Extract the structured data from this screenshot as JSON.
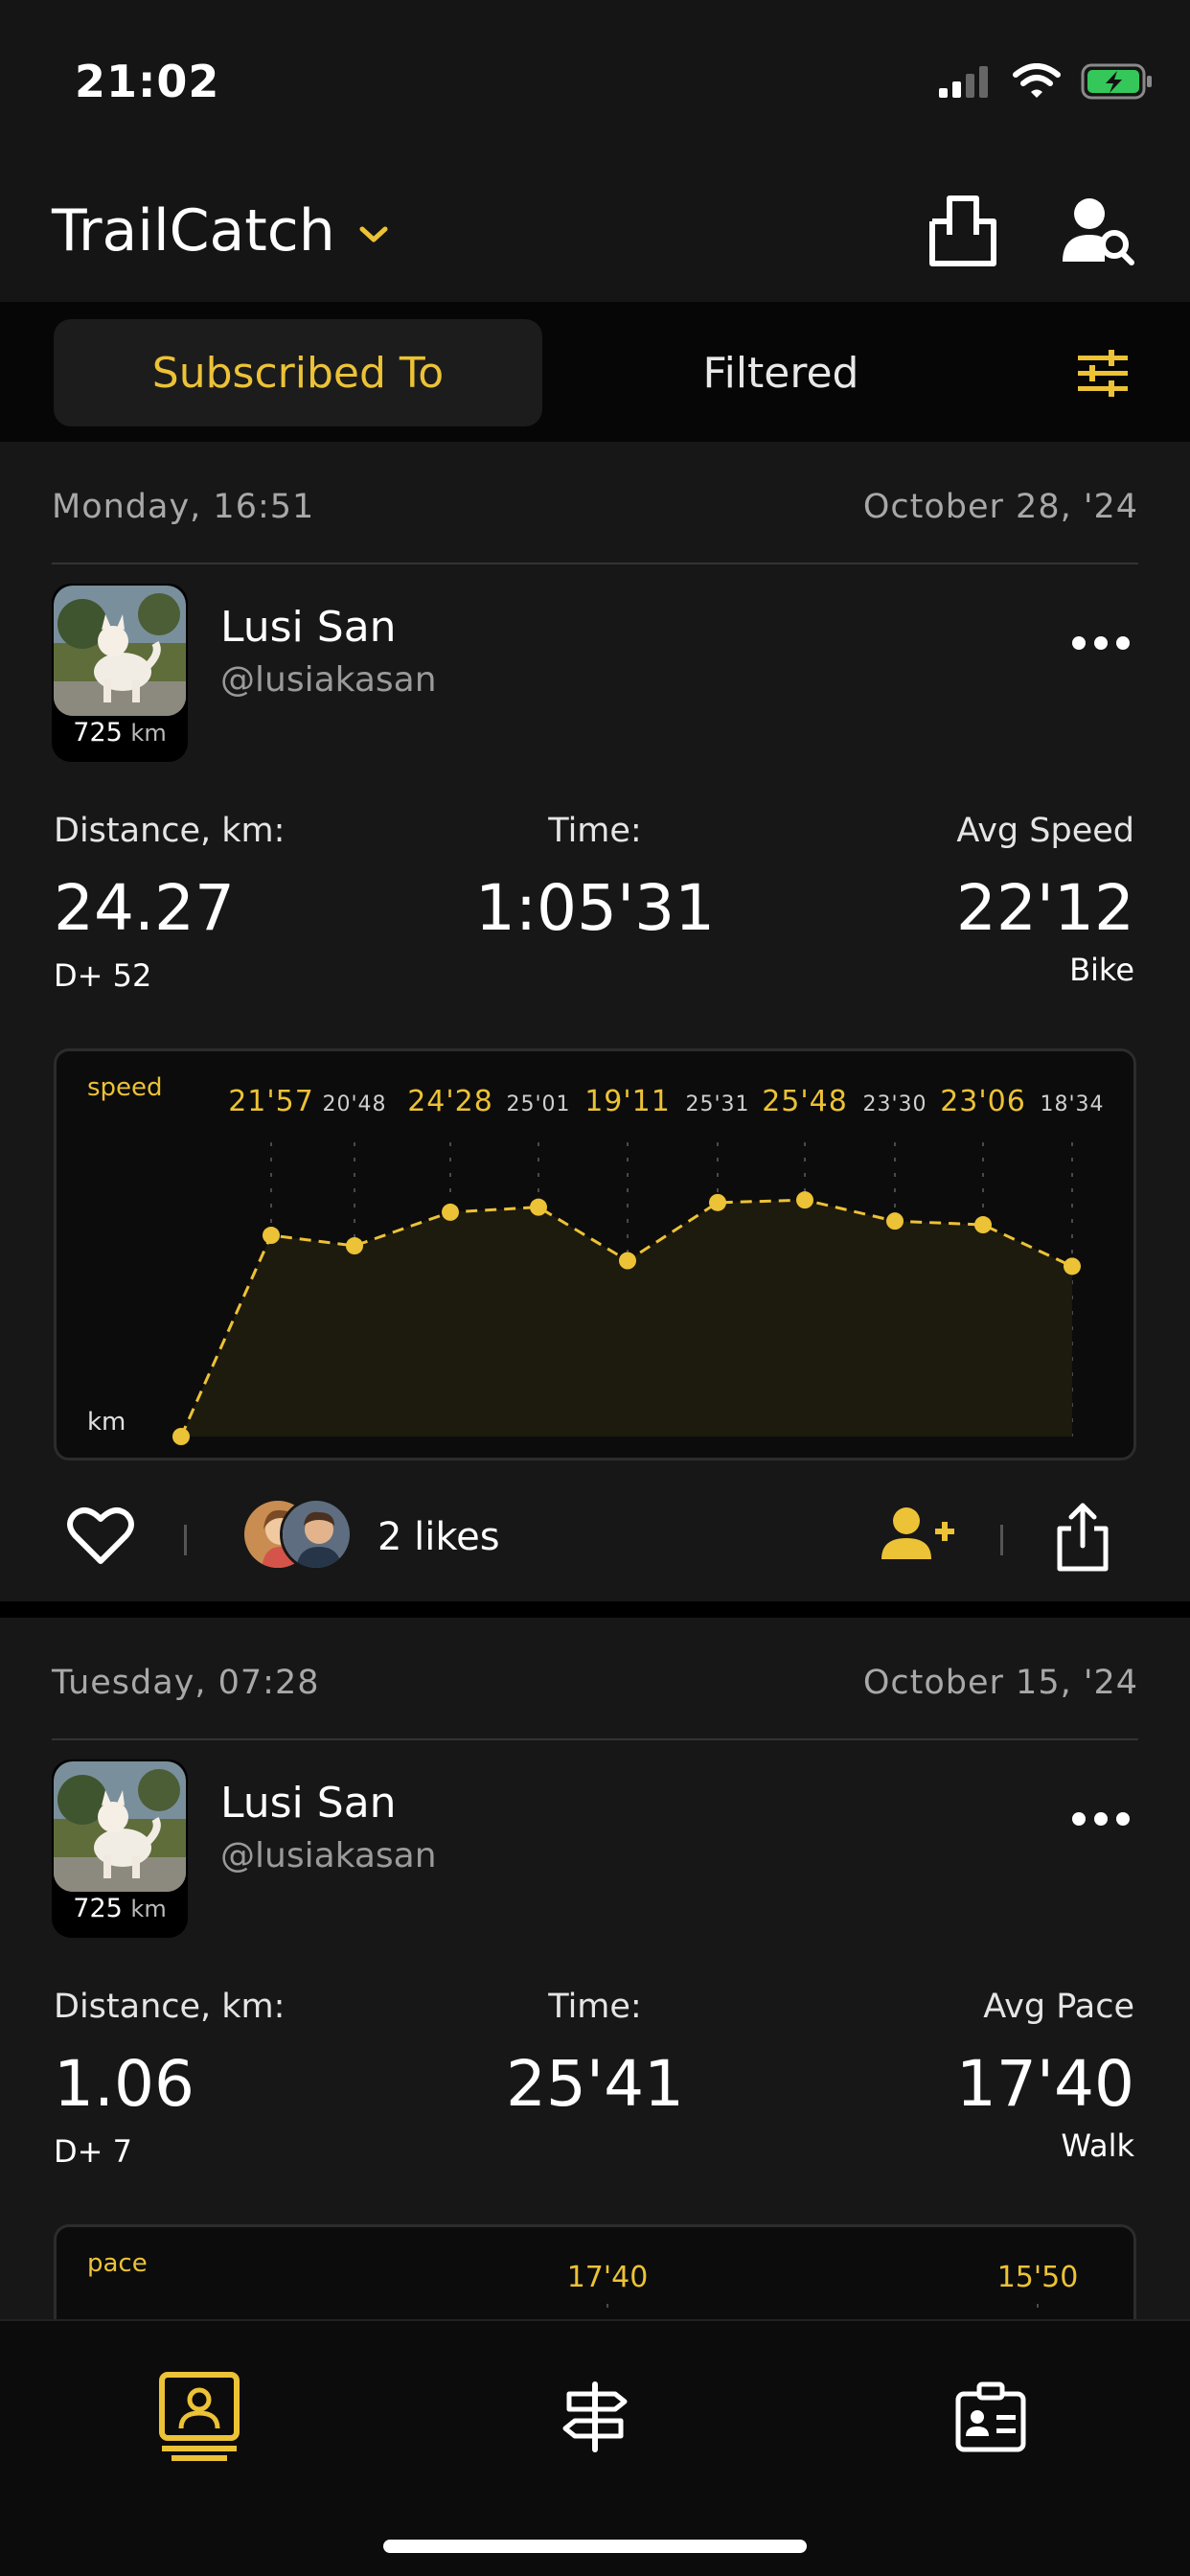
{
  "status_bar": {
    "time": "21:02"
  },
  "header": {
    "title": "TrailCatch"
  },
  "tabs": {
    "active": "Subscribed To",
    "inactive": "Filtered"
  },
  "colors": {
    "accent": "#ECC236",
    "background": "#171717"
  },
  "icons": [
    "chevron-down-icon",
    "upload-box-icon",
    "user-search-icon",
    "sliders-icon",
    "more-icon",
    "heart-icon",
    "add-user-icon",
    "share-icon",
    "profile-card-icon",
    "signpost-icon",
    "id-badge-icon"
  ],
  "posts": [
    {
      "day_time": "Monday, 16:51",
      "date": "October 28, '24",
      "avatar_km": "725",
      "avatar_km_unit": "km",
      "name": "Lusi San",
      "handle": "@lusiakasan",
      "stat1_label": "Distance, km:",
      "stat1_value": "24.27",
      "stat1_sub": "D+ 52",
      "stat2_label": "Time:",
      "stat2_value": "1:05'31",
      "stat3_label": "Avg Speed",
      "stat3_value": "22'12",
      "activity": "Bike",
      "likes": "2 likes"
    },
    {
      "day_time": "Tuesday, 07:28",
      "date": "October 15, '24",
      "avatar_km": "725",
      "avatar_km_unit": "km",
      "name": "Lusi San",
      "handle": "@lusiakasan",
      "stat1_label": "Distance, km:",
      "stat1_value": "1.06",
      "stat1_sub": "D+ 7",
      "stat2_label": "Time:",
      "stat2_value": "25'41",
      "stat3_label": "Avg Pace",
      "stat3_value": "17'40",
      "activity": "Walk"
    }
  ],
  "chart_data": [
    {
      "type": "area",
      "ylabel": "speed",
      "xlabel": "km",
      "top_labels": [
        "21'57",
        "20'48",
        "24'28",
        "25'01",
        "19'11",
        "25'31",
        "25'48",
        "23'30",
        "23'06",
        "18'34"
      ],
      "values": [
        0,
        21.95,
        20.8,
        24.47,
        25.02,
        19.18,
        25.52,
        25.8,
        23.5,
        23.1,
        18.57
      ],
      "ylim": [
        0,
        30
      ]
    },
    {
      "type": "area",
      "ylabel": "pace",
      "top_labels": [
        "17'40",
        "15'50"
      ]
    }
  ]
}
